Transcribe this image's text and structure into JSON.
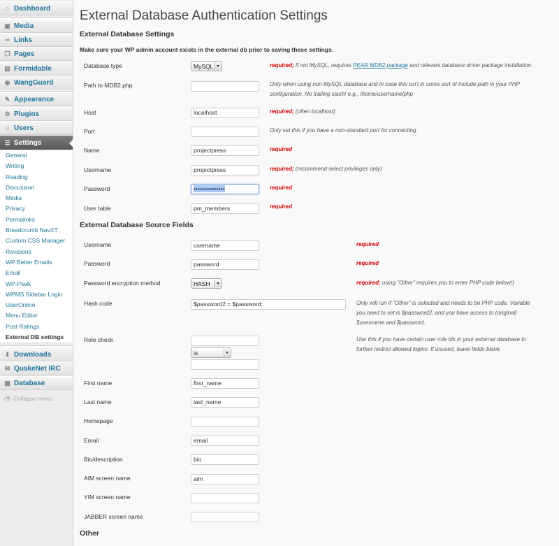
{
  "sidebar": {
    "top_items": [
      {
        "label": "Dashboard",
        "icon": "dashboard-icon"
      },
      {
        "label": "Media",
        "icon": "media-icon"
      },
      {
        "label": "Links",
        "icon": "links-icon"
      },
      {
        "label": "Pages",
        "icon": "pages-icon"
      },
      {
        "label": "Formidable",
        "icon": "formidable-icon"
      },
      {
        "label": "WangGuard",
        "icon": "wangguard-icon"
      },
      {
        "label": "Appearance",
        "icon": "appearance-icon"
      },
      {
        "label": "Plugins",
        "icon": "plugins-icon"
      },
      {
        "label": "Users",
        "icon": "users-icon"
      },
      {
        "label": "Settings",
        "icon": "settings-icon"
      },
      {
        "label": "Downloads",
        "icon": "downloads-icon"
      },
      {
        "label": "QuakeNet IRC",
        "icon": "irc-icon"
      },
      {
        "label": "Database",
        "icon": "database-icon"
      }
    ],
    "settings_submenu": [
      "General",
      "Writing",
      "Reading",
      "Discussion",
      "Media",
      "Privacy",
      "Permalinks",
      "Breadcrumb NavXT",
      "Custom CSS Manager",
      "Revisions",
      "WP Better Emails",
      "Email",
      "WP-Piwik",
      "WPMS Sidebar Login",
      "UserOnline",
      "Menu Editor",
      "Post Ratings",
      "External DB settings"
    ],
    "collapse_label": "Collapse menu"
  },
  "page": {
    "title": "External Database Authentication Settings",
    "section1_title": "External Database Settings",
    "notice": "Make sure your WP admin account exists in the external db prior to saving these settings.",
    "section2_title": "External Database Source Fields",
    "section3_title": "Other"
  },
  "db_settings": {
    "db_type": {
      "label": "Database type",
      "value": "MySQL",
      "req": "required;",
      "desc": " If not MySQL, requires ",
      "link": "PEAR MDB2 package",
      "desc2": " and relevant database driver package installation."
    },
    "mdb2_path": {
      "label": "Path to MDB2.php",
      "value": "",
      "desc_line1": "Only when using non-MySQL database and in case this isn't in some sort of include path in your PHP",
      "desc_line2": "configuration. No trailing slash! e.g., /home/username/php"
    },
    "host": {
      "label": "Host",
      "value": "localhost",
      "req": "required;",
      "desc": " (often localhost)"
    },
    "port": {
      "label": "Port",
      "value": "",
      "desc": "Only set this if you have a non-standard port for connecting."
    },
    "name": {
      "label": "Name",
      "value": "projectpress",
      "req": "required"
    },
    "username": {
      "label": "Username",
      "value": "projectpress",
      "req": "required;",
      "desc": " (recommend select privileges only)"
    },
    "password": {
      "label": "Password",
      "value": "•••••••••••••••",
      "req": "required"
    },
    "user_table": {
      "label": "User table",
      "value": "pm_members",
      "req": "required"
    }
  },
  "source_fields": {
    "username": {
      "label": "Username",
      "value": "username",
      "req": "required"
    },
    "password": {
      "label": "Password",
      "value": "password",
      "req": "required"
    },
    "enc_method": {
      "label": "Password encryption method",
      "value": "HASH",
      "req": "required;",
      "desc": " using \"Other\" requires you to enter PHP code below!)"
    },
    "hash_code": {
      "label": "Hash code",
      "value": "$password2 = $password;",
      "desc_line1": "Only will run if \"Other\" is selected and needs to be PHP code. Variable",
      "desc_line2": "you need to set is $password2, and you have access to (original)",
      "desc_line3": "$username and $password."
    },
    "role_check": {
      "label": "Role check",
      "value1": "",
      "op": "is",
      "value2": "",
      "desc_line1": "Use this if you have certain user role ids in your external database to",
      "desc_line2": "further restrict allowed logins. If unused, leave fields blank."
    },
    "first_name": {
      "label": "First name",
      "value": "first_name"
    },
    "last_name": {
      "label": "Last name",
      "value": "last_name"
    },
    "homepage": {
      "label": "Homepage",
      "value": ""
    },
    "email": {
      "label": "Email",
      "value": "email"
    },
    "bio": {
      "label": "Bio/description",
      "value": "bio"
    },
    "aim": {
      "label": "AIM screen name",
      "value": "aim"
    },
    "yim": {
      "label": "YIM screen name",
      "value": ""
    },
    "jabber": {
      "label": "JABBER screen name",
      "value": ""
    }
  }
}
